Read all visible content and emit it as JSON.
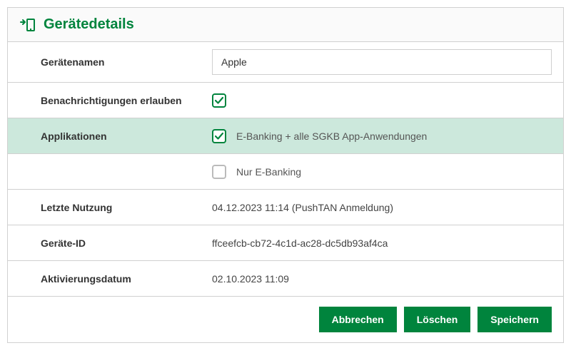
{
  "header": {
    "title": "Gerätedetails"
  },
  "fields": {
    "deviceName": {
      "label": "Gerätenamen",
      "value": "Apple"
    },
    "notifications": {
      "label": "Benachrichtigungen erlauben"
    },
    "applications": {
      "label": "Applikationen",
      "option1": "E-Banking + alle SGKB App-Anwendungen",
      "option2": "Nur E-Banking"
    },
    "lastUse": {
      "label": "Letzte Nutzung",
      "value": "04.12.2023 11:14 (PushTAN Anmeldung)"
    },
    "deviceId": {
      "label": "Geräte-ID",
      "value": "ffceefcb-cb72-4c1d-ac28-dc5db93af4ca"
    },
    "activationDate": {
      "label": "Aktivierungsdatum",
      "value": "02.10.2023 11:09"
    }
  },
  "buttons": {
    "cancel": "Abbrechen",
    "delete": "Löschen",
    "save": "Speichern"
  }
}
